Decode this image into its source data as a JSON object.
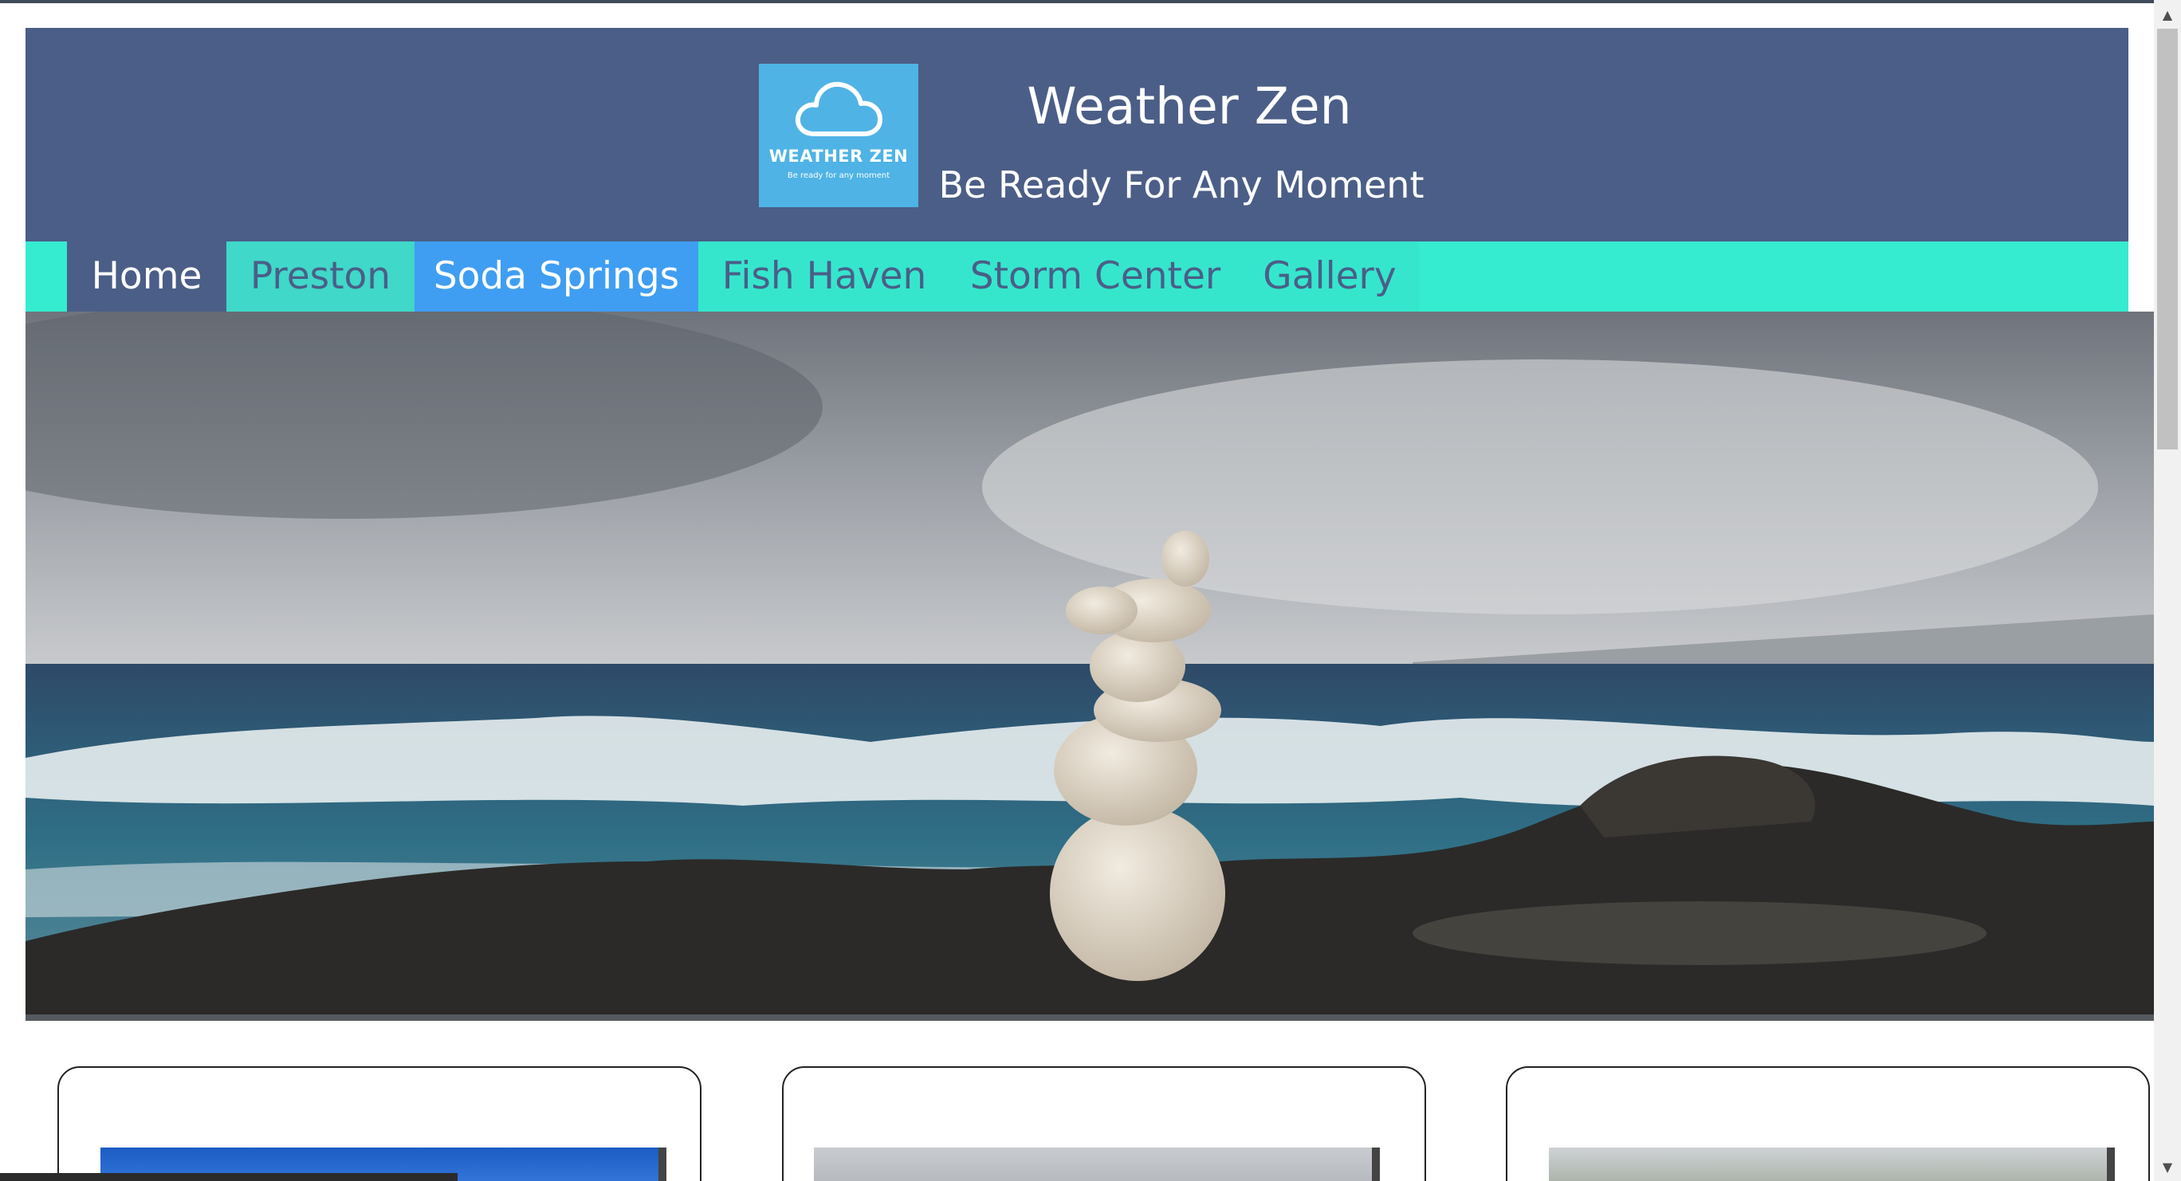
{
  "header": {
    "logo_title": "WEATHER ZEN",
    "logo_tagline": "Be ready for any moment",
    "site_title": "Weather Zen",
    "site_tagline": "Be Ready For Any Moment"
  },
  "nav": {
    "items": [
      {
        "label": "Home"
      },
      {
        "label": "Preston"
      },
      {
        "label": "Soda Springs"
      },
      {
        "label": "Fish Haven"
      },
      {
        "label": "Storm Center"
      },
      {
        "label": "Gallery"
      }
    ]
  },
  "colors": {
    "header_bg": "#4b5e87",
    "nav_bg": "#35ecd0",
    "nav_active": "#4b5e87",
    "nav_hover": "#3f9ef2",
    "logo_bg": "#4fb3e6"
  },
  "icons": {
    "logo": "cloud-icon",
    "scroll_up": "triangle-up-icon",
    "scroll_down": "triangle-down-icon"
  }
}
